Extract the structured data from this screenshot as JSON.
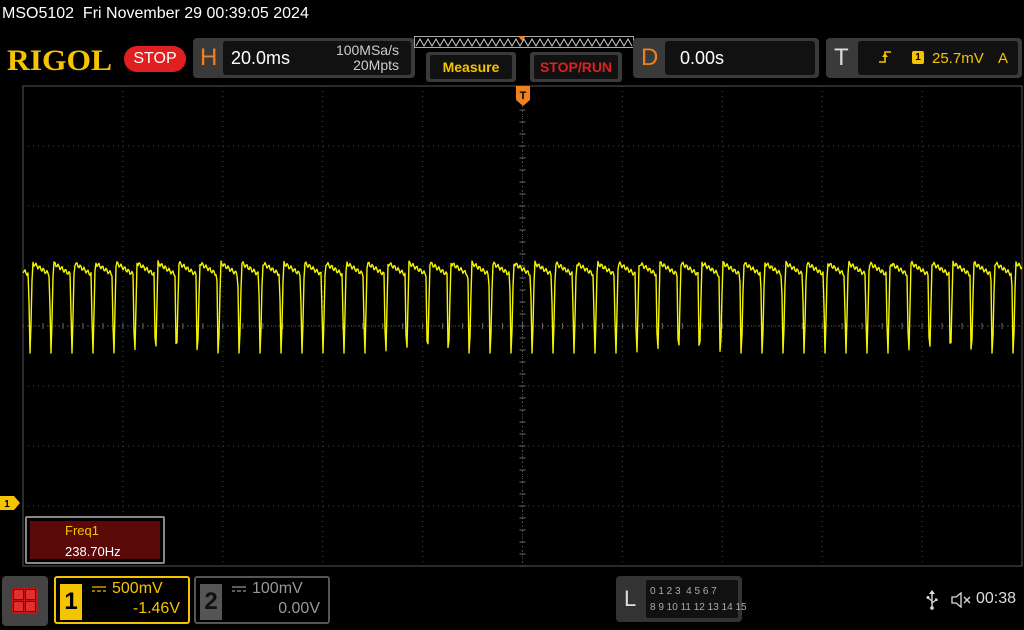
{
  "title_bar": {
    "text": "MSO5102  Fri November 29 00:39:05 2024"
  },
  "header": {
    "logo": "RIGOL",
    "run_state": "STOP",
    "horizontal": {
      "letter": "H",
      "timebase": "20.0ms",
      "sample_rate": "100MSa/s",
      "memory_depth": "20Mpts"
    },
    "buttons": {
      "measure": "Measure",
      "stop_run": "STOP/RUN"
    },
    "delay": {
      "letter": "D",
      "value": "0.00s"
    },
    "trigger": {
      "letter": "T",
      "source": "1",
      "level": "25.7mV",
      "mode": "A",
      "edge_icon": "rising-edge-icon"
    }
  },
  "screen": {
    "grid": {
      "cols": 10,
      "rows": 8
    },
    "trace_color": "#f5f500",
    "trigger_marker": "T",
    "channel_marker": "1",
    "signal": {
      "period_divisions": 0.2094,
      "high_level_divisions": 1.05,
      "low_level_divisions": -0.45,
      "channel_zero_divisions": -2.95
    }
  },
  "measurements": {
    "name": "Freq1",
    "value": "238.70Hz"
  },
  "footer": {
    "channel1": {
      "number": "1",
      "scale": "500mV",
      "offset": "-1.46V",
      "color": "#f5c400"
    },
    "channel2": {
      "number": "2",
      "scale": "100mV",
      "offset": "0.00V",
      "color": "#888888"
    },
    "logic": {
      "letter": "L",
      "row1": "0 1 2 3  4 5 6 7",
      "row2": "8 9 10 11 12 13 14 15"
    },
    "time": "00:38"
  },
  "colors": {
    "accent_yellow": "#f5c400",
    "accent_orange": "#f08020",
    "stop_red": "#e02020"
  }
}
